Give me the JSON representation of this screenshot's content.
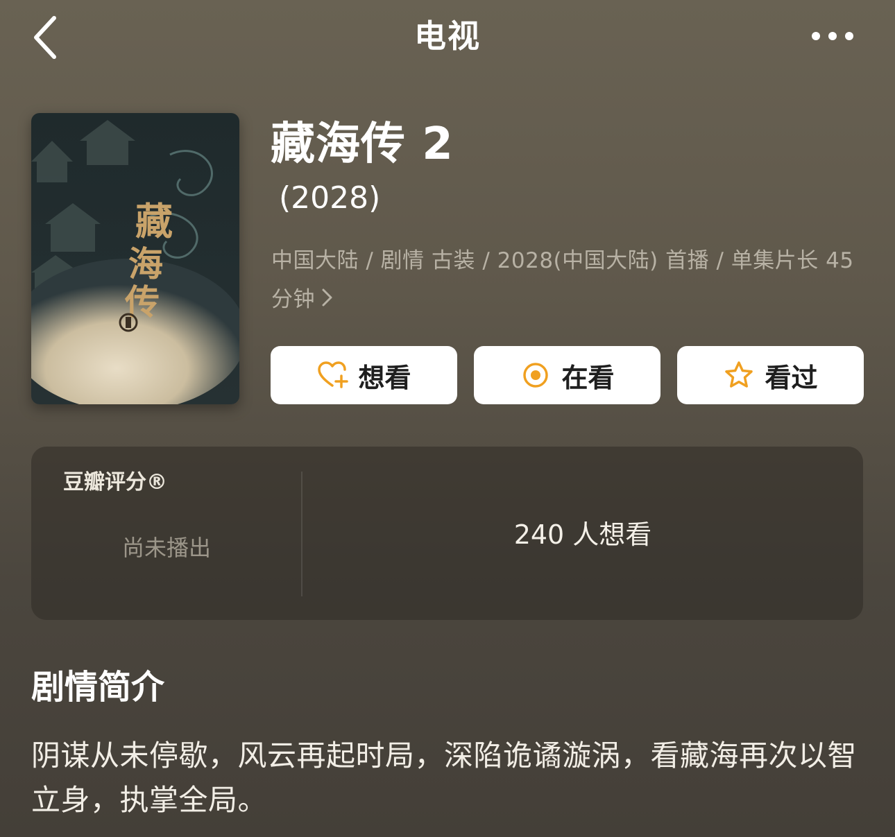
{
  "nav": {
    "title": "电视"
  },
  "show": {
    "title": "藏海传 2",
    "year": "(2028)",
    "meta": "中国大陆 / 剧情 古装 / 2028(中国大陆) 首播 / 单集片长 45 分钟",
    "poster_title": "藏海传"
  },
  "actions": [
    {
      "label": "想看",
      "icon": "heart-plus-icon"
    },
    {
      "label": "在看",
      "icon": "target-circle-icon"
    },
    {
      "label": "看过",
      "icon": "star-outline-icon"
    }
  ],
  "rating": {
    "label": "豆瓣评分®",
    "status": "尚未播出",
    "wish_count": "240 人想看"
  },
  "synopsis": {
    "heading": "剧情简介",
    "text": "阴谋从未停歇，风云再起时局，深陷诡谲漩涡，看藏海再次以智立身，执掌全局。"
  },
  "colors": {
    "accent": "#f0a020",
    "background": "#5f584b",
    "card": "#3a362f"
  }
}
